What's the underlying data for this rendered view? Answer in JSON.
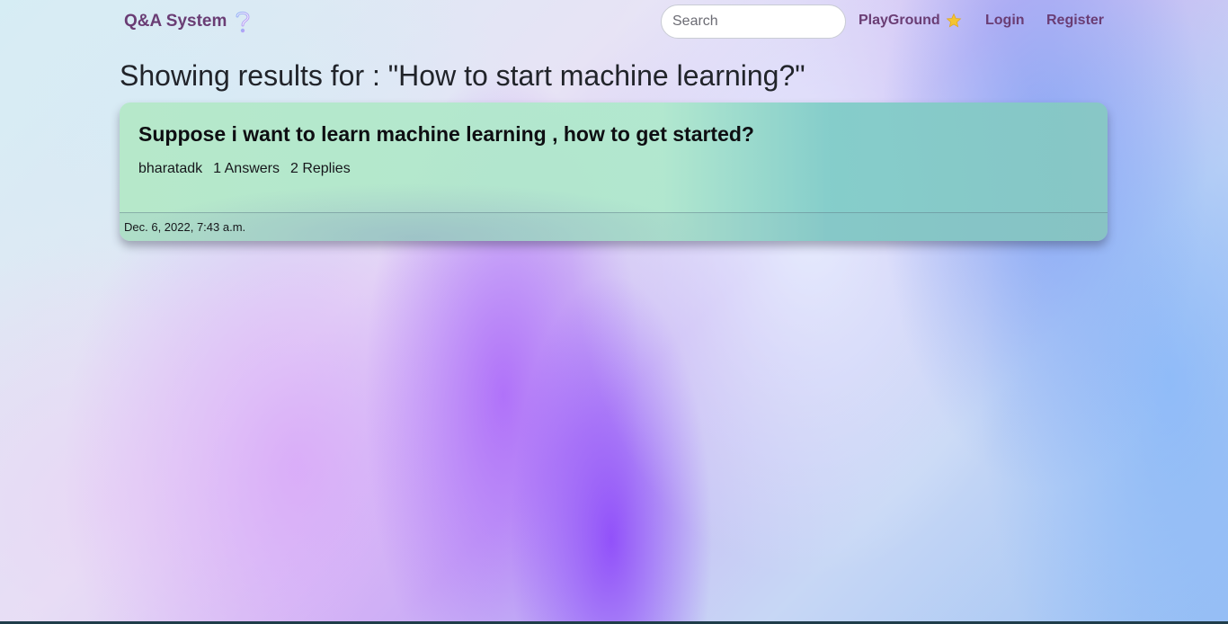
{
  "navbar": {
    "brand": "Q&A System",
    "brand_icon": "question-mark-icon",
    "search_placeholder": "Search",
    "search_value": "",
    "links": {
      "playground": "PlayGround",
      "login": "Login",
      "register": "Register"
    },
    "colors": {
      "link": "#6a3d74",
      "star": "#f4c430"
    }
  },
  "results": {
    "heading": "Showing results for : \"How to start machine learning?\""
  },
  "questions": [
    {
      "title": "Suppose i want to learn machine learning , how to get started?",
      "author": "bharatadk",
      "answers": "1 Answers",
      "replies": "2 Replies",
      "date": "Dec. 6, 2022, 7:43 a.m."
    }
  ]
}
